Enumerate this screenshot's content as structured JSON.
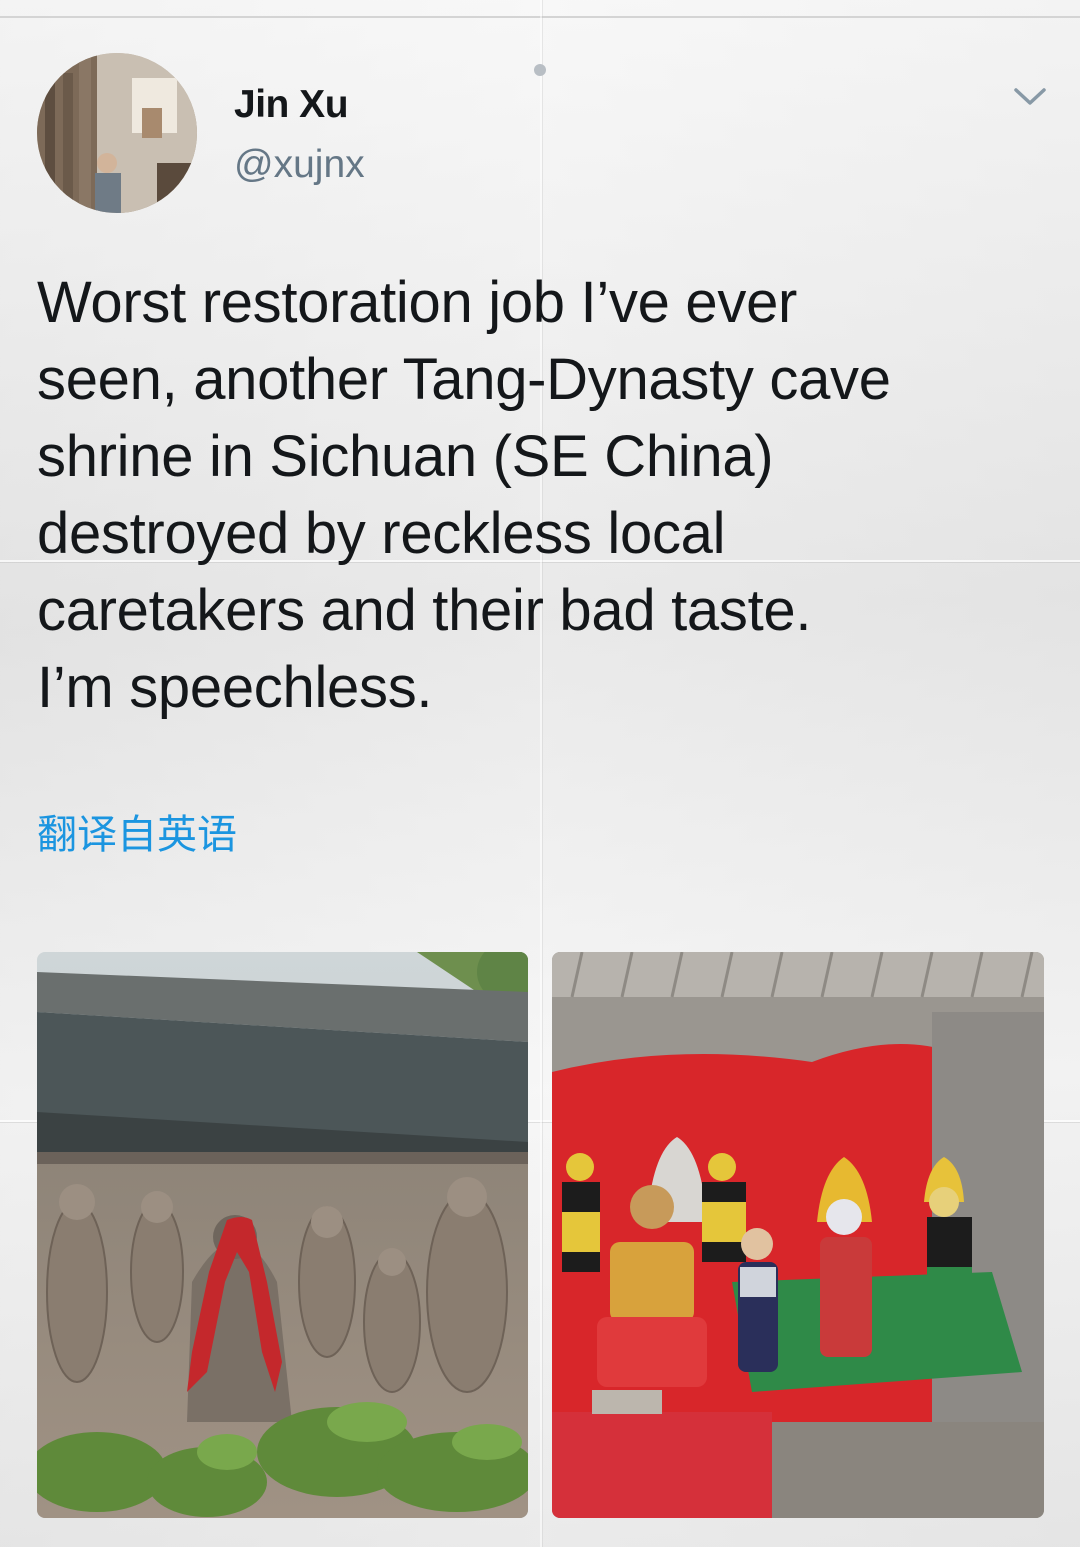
{
  "tweet": {
    "display_name": "Jin Xu",
    "handle": "@xujnx",
    "text": "Worst restoration job I’ve ever\nseen, another Tang-Dynasty cave\nshrine in Sichuan (SE China)\ndestroyed by reckless local\ncaretakers and their bad taste.\nI’m speechless.",
    "translate_label": "翻译自英语",
    "more_icon": "chevron-down-icon",
    "avatar_icon": "avatar",
    "link_color": "#1b95e0",
    "text_color": "#14171a",
    "secondary_color": "#657786"
  },
  "media": {
    "photos": [
      {
        "name": "photo-before-restoration"
      },
      {
        "name": "photo-after-restoration"
      }
    ]
  }
}
